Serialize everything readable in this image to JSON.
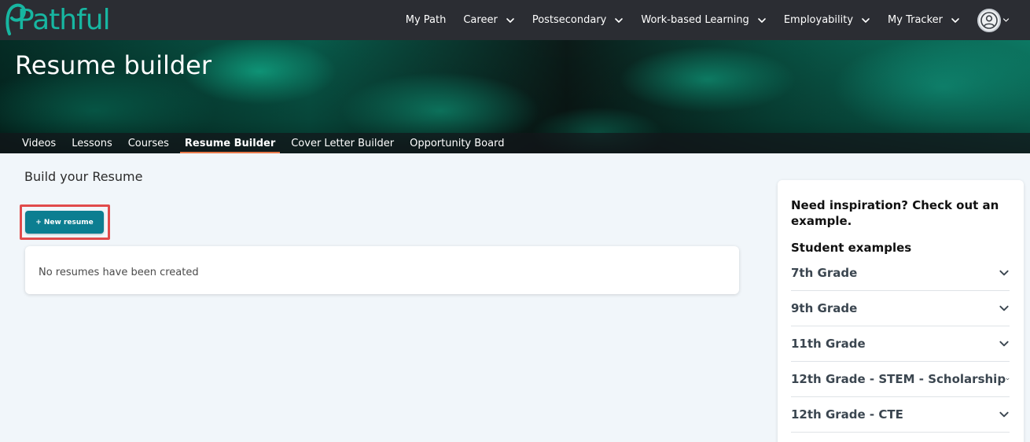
{
  "brand": {
    "logo_text": "Pathful",
    "accent_color": "#17b6a1"
  },
  "topnav": {
    "items": [
      {
        "label": "My Path",
        "has_dropdown": false
      },
      {
        "label": "Career",
        "has_dropdown": true
      },
      {
        "label": "Postsecondary",
        "has_dropdown": true
      },
      {
        "label": "Work-based Learning",
        "has_dropdown": true
      },
      {
        "label": "Employability",
        "has_dropdown": true
      },
      {
        "label": "My Tracker",
        "has_dropdown": true
      }
    ],
    "avatar_icon": "user-circle-icon"
  },
  "hero": {
    "title": "Resume builder"
  },
  "subnav": {
    "tabs": [
      {
        "label": "Videos",
        "active": false
      },
      {
        "label": "Lessons",
        "active": false
      },
      {
        "label": "Courses",
        "active": false
      },
      {
        "label": "Resume Builder",
        "active": true
      },
      {
        "label": "Cover Letter Builder",
        "active": false
      },
      {
        "label": "Opportunity Board",
        "active": false
      }
    ],
    "active_underline_color": "#e8794a"
  },
  "main": {
    "section_title": "Build your Resume",
    "new_resume_label": "+ New resume",
    "button_color": "#0c7e91",
    "highlight_color": "#e14b4b",
    "empty_message": "No resumes have been created"
  },
  "sidebar": {
    "heading": "Need inspiration? Check out an example.",
    "subheading": "Student examples",
    "examples": [
      {
        "label": "7th Grade"
      },
      {
        "label": "9th Grade"
      },
      {
        "label": "11th Grade"
      },
      {
        "label": "12th Grade - STEM - Scholarship"
      },
      {
        "label": "12th Grade - CTE"
      }
    ]
  }
}
